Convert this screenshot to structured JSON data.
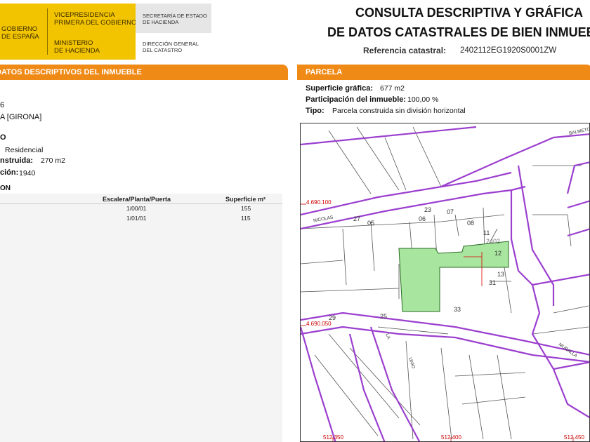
{
  "header": {
    "gov_line1": "GOBIERNO",
    "gov_line2": "DE ESPAÑA",
    "vice_line1": "VICEPRESIDENCIA",
    "vice_line2": "PRIMERA DEL GOBIERNO",
    "ministry_line1": "MINISTERIO",
    "ministry_line2": "DE HACIENDA",
    "secretaria_line1": "SECRETARÍA DE ESTADO",
    "secretaria_line2": "DE HACIENDA",
    "direccion_line1": "DIRECCIÓN GENERAL",
    "direccion_line2": "DEL CATASTRO",
    "title_line1": "CONSULTA DESCRIPTIVA Y GRÁFICA",
    "title_line2": "DE DATOS CATASTRALES DE BIEN INMUEBLE",
    "ref_label": "Referencia catastral:",
    "ref_value": "2402112EG1920S0001ZW"
  },
  "left": {
    "bar_title": "DATOS DESCRIPTIVOS DEL INMUEBLE",
    "address_fragment": "6",
    "municipality": "A [GIRONA]",
    "clase_fragment": "O",
    "uso_value": "Residencial",
    "sup_label": "nstruida:",
    "sup_value": "270 m2",
    "year_label": "ción:",
    "year_value": "1940",
    "section_fragment": "ON",
    "table": {
      "headers": [
        "Escalera/Planta/Puerta",
        "Superficie m²"
      ],
      "rows": [
        [
          "1/00/01",
          "155"
        ],
        [
          "1/01/01",
          "115"
        ]
      ]
    }
  },
  "parcela": {
    "bar_title": "PARCELA",
    "sup_label": "Superficie gráfica:",
    "sup_value": "677 m2",
    "part_label": "Participación del inmueble:",
    "part_value": "100,00 %",
    "tipo_label": "Tipo:",
    "tipo_value": "Parcela construida sin división horizontal"
  },
  "map": {
    "coord_y1": "4.690.100",
    "coord_y2": "4.690.050",
    "coord_x1": "512.350",
    "coord_x2": "512.400",
    "coord_x3": "512.450",
    "parcel_ref": "2402",
    "street_names": [
      "NICOLAS",
      "BALMETO",
      "MURALLA",
      "UNIO",
      "LA"
    ],
    "parcel_numbers": [
      "05",
      "06",
      "07",
      "08",
      "11",
      "12",
      "13",
      "31",
      "33",
      "25",
      "23",
      "27",
      "29"
    ]
  },
  "colors": {
    "orange": "#f08a17",
    "gov_yellow": "#f2c400",
    "parcel_line": "#9b3fcf",
    "highlight_parcel": "#a8e6a0"
  }
}
